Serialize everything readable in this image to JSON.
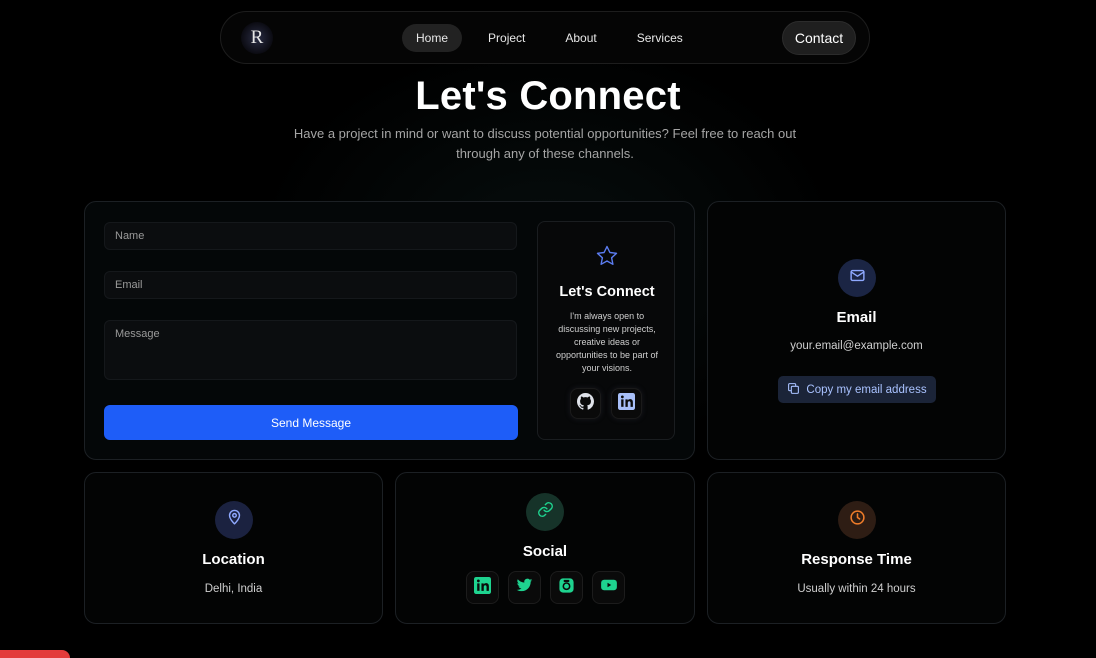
{
  "nav": {
    "logo_letter": "R",
    "links": [
      {
        "label": "Home",
        "active": true
      },
      {
        "label": "Project",
        "active": false
      },
      {
        "label": "About",
        "active": false
      },
      {
        "label": "Services",
        "active": false
      }
    ],
    "contact_label": "Contact"
  },
  "hero": {
    "title": "Let's Connect",
    "subtitle": "Have a project in mind or want to discuss potential opportunities? Feel free to reach out through any of these channels."
  },
  "form": {
    "name_placeholder": "Name",
    "email_placeholder": "Email",
    "message_placeholder": "Message",
    "send_label": "Send Message"
  },
  "connect_card": {
    "icon": "star-icon",
    "title": "Let's Connect",
    "description": "I'm always open to discussing new projects, creative ideas or opportunities to be part of your visions.",
    "buttons": [
      "github-icon",
      "linkedin-icon"
    ]
  },
  "email_card": {
    "icon": "mail-icon",
    "title": "Email",
    "value": "your.email@example.com",
    "copy_label": "Copy my email address"
  },
  "location_card": {
    "icon": "location-pin-icon",
    "title": "Location",
    "value": "Delhi, India"
  },
  "social_card": {
    "icon": "link-icon",
    "title": "Social",
    "buttons": [
      "linkedin-icon",
      "twitter-icon",
      "camera-icon",
      "youtube-icon"
    ]
  },
  "response_card": {
    "icon": "clock-icon",
    "title": "Response Time",
    "value": "Usually within 24 hours"
  },
  "colors": {
    "accent_blue": "#1e5df8",
    "social_green": "#1ed38f",
    "response_orange": "#f07d2a",
    "background": "#000000"
  }
}
